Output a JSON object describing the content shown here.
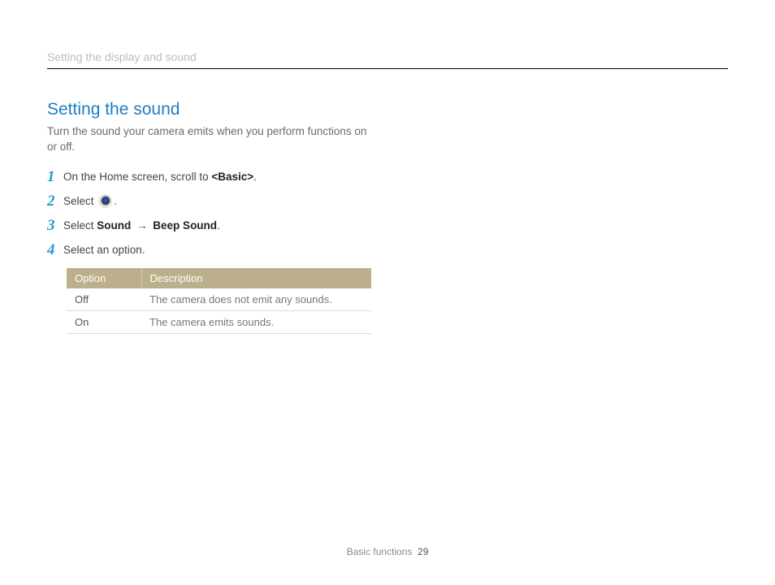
{
  "header": {
    "running_title": "Setting the display and sound"
  },
  "section": {
    "title": "Setting the sound",
    "intro": "Turn the sound your camera emits when you perform functions on or off."
  },
  "steps": [
    {
      "num": "1",
      "pre": "On the Home screen, scroll to ",
      "bold1": "<Basic>",
      "post": "."
    },
    {
      "num": "2",
      "pre": "Select ",
      "icon": true,
      "post": "."
    },
    {
      "num": "3",
      "pre": "Select ",
      "bold1": "Sound",
      "arrow": " → ",
      "bold2": "Beep Sound",
      "post": "."
    },
    {
      "num": "4",
      "pre": "Select an option."
    }
  ],
  "table": {
    "headers": [
      "Option",
      "Description"
    ],
    "rows": [
      [
        "Off",
        "The camera does not emit any sounds."
      ],
      [
        "On",
        "The camera emits sounds."
      ]
    ]
  },
  "footer": {
    "section": "Basic functions",
    "page": "29"
  }
}
